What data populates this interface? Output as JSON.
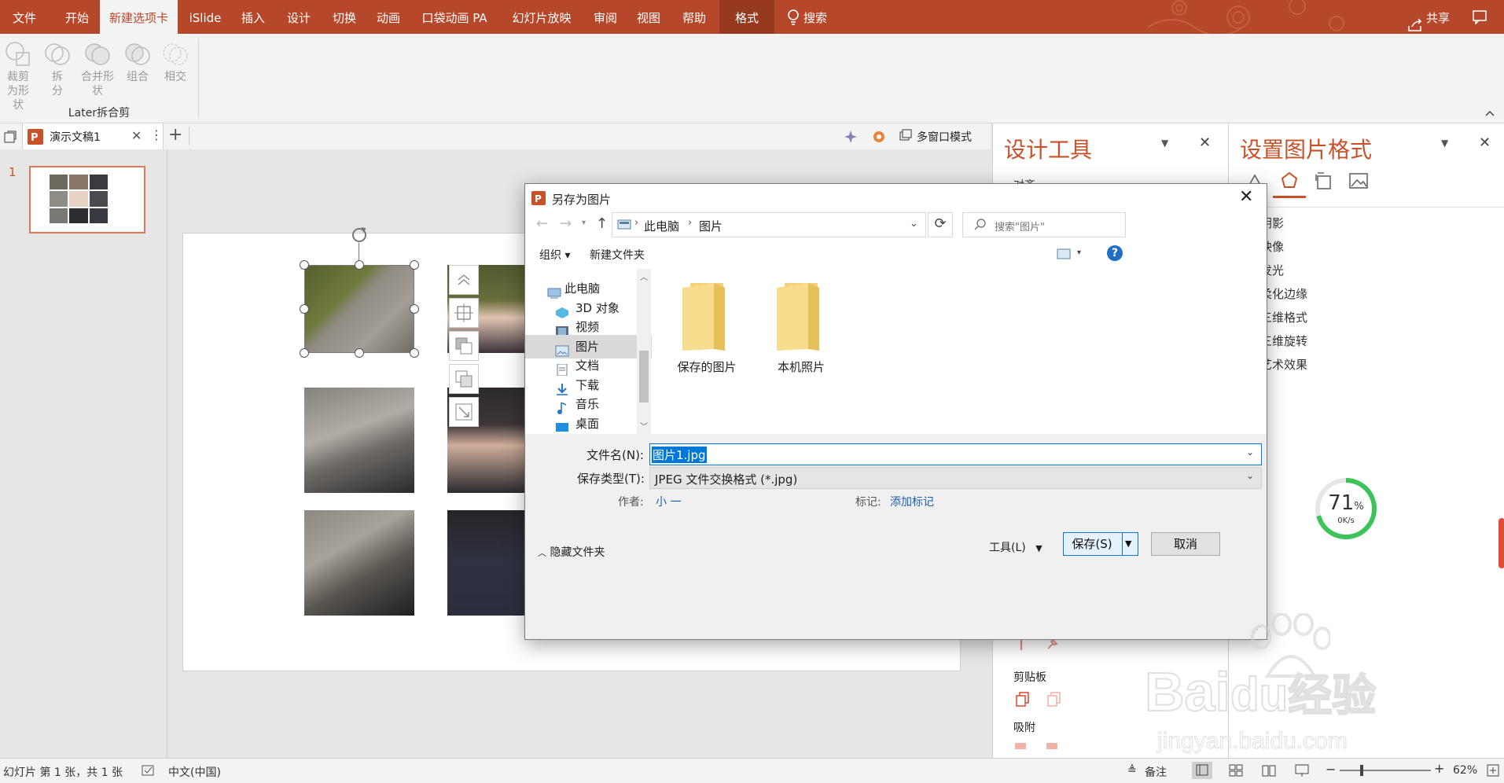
{
  "ribbon": {
    "tabs": [
      "文件",
      "开始",
      "新建选项卡",
      "iSlide",
      "插入",
      "设计",
      "切换",
      "动画",
      "口袋动画 PA",
      "幻灯片放映",
      "审阅",
      "视图",
      "帮助",
      "格式"
    ],
    "active_tab": "新建选项卡",
    "search": "搜索",
    "share": "共享",
    "buttons": [
      "裁剪为形状",
      "拆分",
      "合并形状",
      "组合",
      "相交"
    ],
    "group_label": "Later拆合剪"
  },
  "doc_tab": {
    "title": "演示文稿1",
    "window_mode": "多窗口模式"
  },
  "thumbnails": {
    "slide_number": "1"
  },
  "design_pane": {
    "title": "设计工具",
    "partial_label": "对齐",
    "sections": [
      "剪贴板",
      "吸附"
    ]
  },
  "format_pane": {
    "title": "设置图片格式",
    "items": [
      "阴影",
      "映像",
      "发光",
      "柔化边缘",
      "三维格式",
      "三维旋转",
      "艺术效果"
    ]
  },
  "net_widget": {
    "percent": "71",
    "unit": "%",
    "speed": "0K/s"
  },
  "status": {
    "slide_info": "幻灯片 第 1 张，共 1 张",
    "language": "中文(中国)",
    "notes": "备注",
    "zoom": "62%"
  },
  "dialog": {
    "title": "另存为图片",
    "breadcrumb": [
      "此电脑",
      "图片"
    ],
    "search_placeholder": "搜索\"图片\"",
    "organize": "组织",
    "new_folder": "新建文件夹",
    "nav": [
      "此电脑",
      "3D 对象",
      "视频",
      "图片",
      "文档",
      "下载",
      "音乐",
      "桌面"
    ],
    "selected_nav": "图片",
    "folders": [
      "保存的图片",
      "本机照片"
    ],
    "filename_label": "文件名(N):",
    "filename_value": "图片1.jpg",
    "filetype_label": "保存类型(T):",
    "filetype_value": "JPEG 文件交换格式 (*.jpg)",
    "author_label": "作者:",
    "author_value": "小 一",
    "tags_label": "标记:",
    "tags_value": "添加标记",
    "hide_folders": "隐藏文件夹",
    "tools": "工具(L)",
    "save": "保存(S)",
    "cancel": "取消"
  },
  "watermark": {
    "brand": "Bai",
    "brand2": "du",
    "brand_cn": "经验",
    "url": "jingyan.baidu.com"
  }
}
